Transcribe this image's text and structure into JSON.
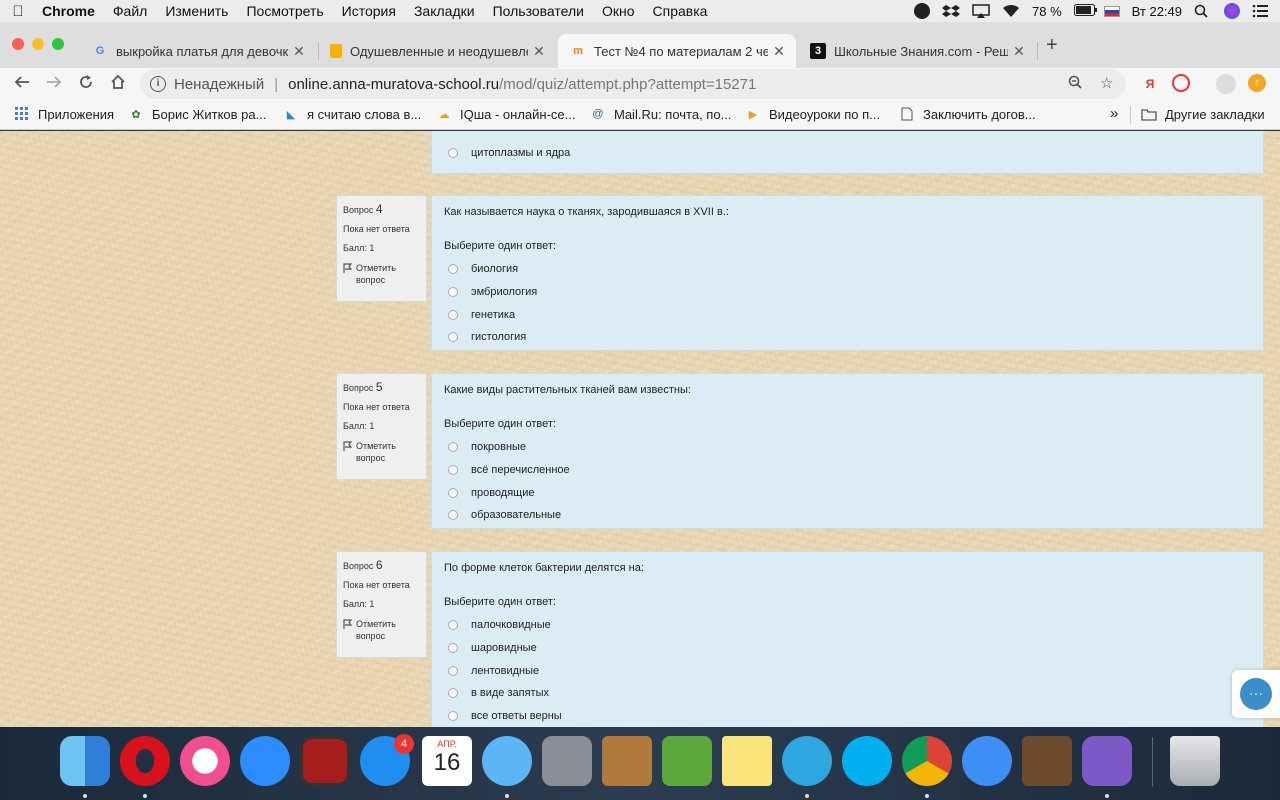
{
  "menubar": {
    "app": "Chrome",
    "items": [
      "Файл",
      "Изменить",
      "Посмотреть",
      "История",
      "Закладки",
      "Пользователи",
      "Окно",
      "Справка"
    ],
    "battery": "78 %",
    "clock": "Вт 22:49"
  },
  "tabs": [
    {
      "title": "выкройка платья для девочке",
      "icon": "google-icon"
    },
    {
      "title": "Одушевленные и неодушевле",
      "icon": "slides-icon"
    },
    {
      "title": "Тест №4 по материалам 2 че",
      "icon": "moodle-icon"
    },
    {
      "title": "Школьные Знания.com - Реш",
      "icon": "znanija-icon"
    }
  ],
  "toolbar": {
    "security": "Ненадежный",
    "host": "online.anna-muratova-school.ru",
    "path": "/mod/quiz/attempt.php?attempt=15271"
  },
  "bookmarks": {
    "items": [
      "Приложения",
      "Борис Житков ра...",
      "я считаю слова в...",
      "IQша - онлайн-се...",
      "Mail.Ru: почта, по...",
      "Видеоуроки по п...",
      "Заключить догов..."
    ],
    "more": "»",
    "other": "Другие закладки"
  },
  "prev_question": {
    "answer": "цитоплазмы и ядра"
  },
  "questions": [
    {
      "label": "Вопрос",
      "number": "4",
      "status": "Пока нет ответа",
      "grade": "Балл: 1",
      "flag": "Отметить вопрос",
      "text": "Как называется наука о тканях, зародившаяся в XVII в.:",
      "prompt": "Выберите один ответ:",
      "answers": [
        "биология",
        "эмбриология",
        "генетика",
        "гистология"
      ]
    },
    {
      "label": "Вопрос",
      "number": "5",
      "status": "Пока нет ответа",
      "grade": "Балл: 1",
      "flag": "Отметить вопрос",
      "text": "Какие виды растительных тканей вам известны:",
      "prompt": "Выберите один ответ:",
      "answers": [
        "покровные",
        "всё перечисленное",
        "проводящие",
        "образовательные"
      ]
    },
    {
      "label": "Вопрос",
      "number": "6",
      "status": "Пока нет ответа",
      "grade": "Балл: 1",
      "flag": "Отметить вопрос",
      "text": "По форме клеток бактерии делятся на:",
      "prompt": "Выберите один ответ:",
      "answers": [
        "палочковидные",
        "шаровидные",
        "лентовидные",
        "в виде запятых",
        "все ответы верны"
      ]
    }
  ],
  "dock": {
    "app_store_badge": "4",
    "calendar_month": "АПР.",
    "calendar_day": "16"
  },
  "colors": {
    "page_background": "#e9d6b3",
    "question_background": "#dcecf5",
    "info_background": "#efefef"
  }
}
